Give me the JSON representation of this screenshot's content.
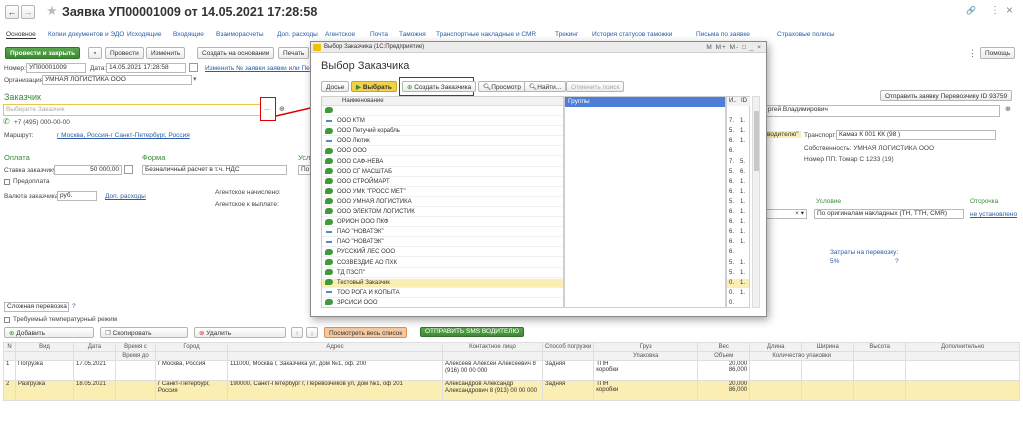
{
  "window": {
    "nav_back": "←",
    "nav_fwd": "→",
    "star": "★",
    "title": "Заявка УП00001009 от 14.05.2021 17:28:58",
    "link_icon": "🔗",
    "more": "⋮",
    "close": "×"
  },
  "tabs": [
    "Основное",
    "Копии документов и ЭДО",
    "Исходящие",
    "Входящие",
    "Взаиморасчеты",
    "Доп. расходы",
    "Агентское",
    "Почта",
    "Таможня",
    "Транспортные накладные и СМR",
    "Трекинг",
    "История статусов таможки",
    "Письма по заявке",
    "Страховые полисы"
  ],
  "toolbar": {
    "post_close": "Провести и закрыть",
    "post": "Провести",
    "change": "Изменить",
    "create_based": "Создать на основании",
    "print": "Печать",
    "help": "Помощь",
    "more": "⋮"
  },
  "header": {
    "number_label": "Номер:",
    "number_value": "УП00001009",
    "date_label": "Дата:",
    "date_value": "14.05.2021 17:28:58",
    "change_link": "Изменить № заявки заявки или Пе",
    "org_label": "Организация:",
    "org_value": "УМНАЯ ЛОГИСТИКА ООО"
  },
  "customer": {
    "section": "Заказчик",
    "placeholder": "Выберите Заказчик",
    "phone": "+7 (495) 000-00-00",
    "route_label": "Маршрут:",
    "route_value": "г Москва, Россия-г Санкт-Петербург, Россия"
  },
  "payment": {
    "section_pay": "Оплата",
    "section_form": "Форма",
    "section_cond": "Усло",
    "rate_label": "Ставка заказчику:",
    "rate_value": "50 000,00",
    "form_value": "Безналичный расчет в т.ч. НДС",
    "cond_value": "По с",
    "prepay": "Предоплата",
    "currency_label": "Валюта заказчика:",
    "currency_value": "руб.",
    "extra_link": "Доп. расходы",
    "agent_accrued": "Агентское начислено:",
    "agent_payable": "Агентское к выплате:"
  },
  "right_panel": {
    "send_request": "Отправить заявку Перевозчику ID 93759",
    "driver_value": "ргей Владимирович",
    "driver_tag": "водителю\"",
    "transport_label": "Транспорт:",
    "transport_value": "Камаз  К 001 КК (98 )",
    "owner": "Собственность: УМНАЯ ЛОГИСТИКА ООО",
    "trailer": "Номер ПП: Томар С 1233 (19)",
    "cond_label": "Условие",
    "cond_value": "По оригиналам накладных (ТН, ТТН, СМR)",
    "delay_label": "Отсрочка",
    "delay_value": "не установлено",
    "costs_label": "Затраты на перевозку:",
    "costs_value": "5%",
    "costs_q": "?"
  },
  "cargo": {
    "type_value": "Сложная перевозка",
    "q": "?",
    "temp_label": "Требуемый температурный режим",
    "add": "Добавить",
    "copy": "Скопировать",
    "delete": "Удалить",
    "view_all": "Посмотреть весь список",
    "sms": "ОТПРАВИТЬ SMS ВОДИТЕЛЮ"
  },
  "grid": {
    "headers1": [
      "N",
      "Вид",
      "Дата",
      "Время с",
      "Город",
      "Адрес",
      "Контактное лицо",
      "Способ погрузки",
      "Груз",
      "Вес",
      "Длина",
      "Ширина",
      "Высота",
      "Дополнительно"
    ],
    "headers2": [
      "",
      "",
      "",
      "Время до",
      "",
      "",
      "",
      "",
      "Упаковка",
      "Объем",
      "Количество упаковки",
      "",
      "",
      ""
    ],
    "rows": [
      {
        "n": "1",
        "kind": "Погрузка",
        "date": "17.05.2021",
        "city": "г Москва, Россия",
        "address": "111000, Москва г, Заказчика ул, дом №1, оф. 200",
        "contact": "Алексеев Алексей Алексеевич 8 (916) 00 00 000",
        "method": "Задняя",
        "cargo": "ТПН",
        "pack": "коробки",
        "weight": "20,000",
        "volume": "86,000"
      },
      {
        "n": "2",
        "kind": "Разгрузка",
        "date": "18.05.2021",
        "city": "г Санкт-Петербург, Россия",
        "address": "190000, Санкт-Петербург г, Перевозчиков ул, дом №1, оф 201",
        "contact": "Александров Александр Александрович 8 (913) 00 00 000",
        "method": "Задняя",
        "cargo": "ТПН",
        "pack": "коробки",
        "weight": "20,000",
        "volume": "86,000"
      }
    ]
  },
  "dialog": {
    "titlebar": "Выбор Заказчика  (1С:Предприятие)",
    "title": "Выбор Заказчика",
    "controls": "M M+ M- □ _ ×",
    "dossier": "Досье",
    "select": "Выбрать",
    "create": "Создать Заказчика",
    "view": "Просмотр",
    "find": "Найти...",
    "cancel_search": "Отменить поиск",
    "col_name": "Наименование",
    "col_groups": "Группы",
    "col_i": "И..",
    "col_id": "ID",
    "items": [
      {
        "icon": "green",
        "name": "",
        "i": "",
        "id": ""
      },
      {
        "icon": "blue",
        "name": "ООО КТМ",
        "i": "7.",
        "id": "1."
      },
      {
        "icon": "green",
        "name": "ООО Петучий корабль",
        "i": "5.",
        "id": "1."
      },
      {
        "icon": "blue",
        "name": "ООО Лютик",
        "i": "6.",
        "id": "1."
      },
      {
        "icon": "green",
        "name": "ООО ООО",
        "i": "6.",
        "id": ""
      },
      {
        "icon": "green",
        "name": "ООО САФ-НЕВА",
        "i": "7.",
        "id": "5."
      },
      {
        "icon": "green",
        "name": "ООО СГ МАСШТАБ",
        "i": "5.",
        "id": "6."
      },
      {
        "icon": "green",
        "name": "ООО СТРОЙМАРТ",
        "i": "6.",
        "id": "1."
      },
      {
        "icon": "green",
        "name": "ООО УМК \"ГРОСС МЕТ\"",
        "i": "6.",
        "id": "1."
      },
      {
        "icon": "green",
        "name": "ООО УМНАЯ ЛОГИСТИКА",
        "i": "5.",
        "id": "1."
      },
      {
        "icon": "green",
        "name": "ООО ЭЛЕКТОМ ЛОГИСТИК",
        "i": "6.",
        "id": "1."
      },
      {
        "icon": "green",
        "name": "ОРИОН ООО ПКФ",
        "i": "6.",
        "id": "1."
      },
      {
        "icon": "blue",
        "name": "ПАО \"НОВАТЭК\"",
        "i": "6.",
        "id": "1."
      },
      {
        "icon": "blue",
        "name": "ПАО \"НОВАТЭК\"",
        "i": "6.",
        "id": "1."
      },
      {
        "icon": "green",
        "name": "РУССКИЙ ЛЕС ООО",
        "i": "6.",
        "id": ""
      },
      {
        "icon": "green",
        "name": "СОЗВЕЗДИЕ АО ПХК",
        "i": "5.",
        "id": "1."
      },
      {
        "icon": "green",
        "name": "ТД ПЗСП\"",
        "i": "5.",
        "id": "1."
      },
      {
        "icon": "green",
        "name": "Тестовый Заказчик",
        "i": "0.",
        "id": "1.",
        "selected": true
      },
      {
        "icon": "blue",
        "name": "ТОО РОГА И КОПЫТА",
        "i": "0.",
        "id": "1."
      },
      {
        "icon": "green",
        "name": "ЗРСИСИ ООО",
        "i": "0.",
        "id": ""
      }
    ]
  },
  "colors": {
    "accent_green": "#3d8a33",
    "highlight_red": "#e00000",
    "selected_row": "#fbeeb2",
    "group_blue": "#4e7fd6"
  }
}
